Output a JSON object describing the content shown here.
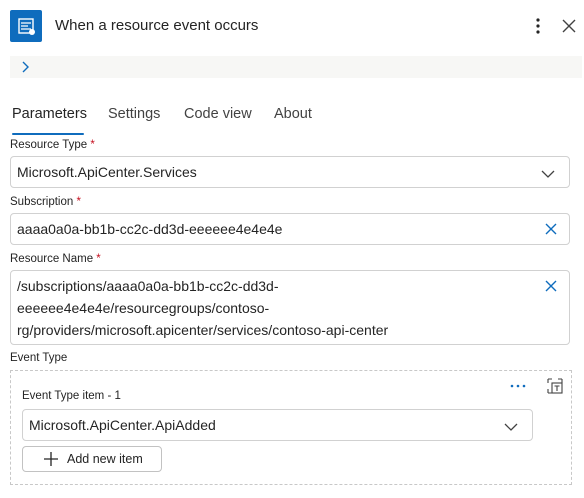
{
  "header": {
    "title": "When a resource event occurs",
    "app_icon": "event-grid-icon",
    "more_icon": "more-vertical-icon",
    "close_icon": "close-icon"
  },
  "tabs": [
    {
      "label": "Parameters",
      "active": true
    },
    {
      "label": "Settings",
      "active": false
    },
    {
      "label": "Code view",
      "active": false
    },
    {
      "label": "About",
      "active": false
    }
  ],
  "form": {
    "resource_type": {
      "label": "Resource Type",
      "required": "*",
      "value": "Microsoft.ApiCenter.Services"
    },
    "subscription": {
      "label": "Subscription",
      "required": "*",
      "value": "aaaa0a0a-bb1b-cc2c-dd3d-eeeeee4e4e4e"
    },
    "resource_name": {
      "label": "Resource Name",
      "required": "*",
      "lines": [
        "/subscriptions/aaaa0a0a-bb1b-cc2c-dd3d-",
        "eeeeee4e4e4e/resourcegroups/contoso-",
        "rg/providers/microsoft.apicenter/services/contoso-api-center"
      ]
    },
    "event_type": {
      "label": "Event Type",
      "item_label": "Event Type item - 1",
      "item_value": "Microsoft.ApiCenter.ApiAdded",
      "add_label": "Add new item"
    }
  },
  "colors": {
    "accent": "#0f6cbd",
    "required": "#c50f1f",
    "border": "#d1d1d1"
  }
}
